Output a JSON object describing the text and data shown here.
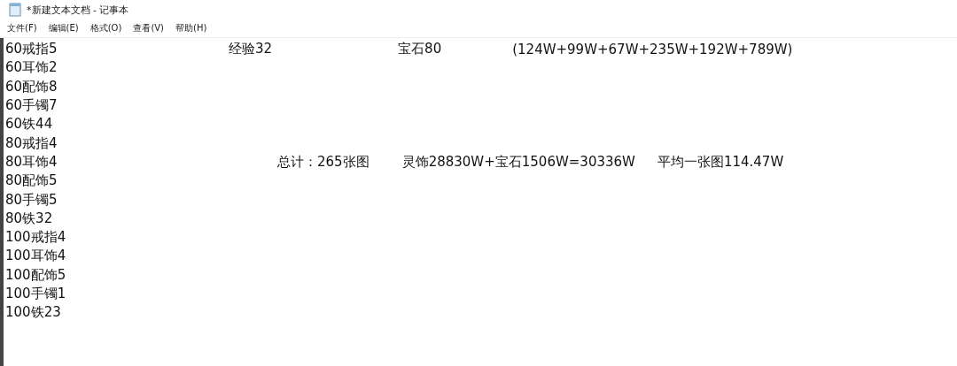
{
  "window": {
    "title": "*新建文本文档 - 记事本"
  },
  "menu": [
    "文件(F)",
    "编辑(E)",
    "格式(O)",
    "查看(V)",
    "帮助(H)"
  ],
  "lines": [
    {
      "text": "60戒指5",
      "notes": [
        "经验32",
        "宝石80",
        "(124W+99W+67W+235W+192W+789W)"
      ]
    },
    {
      "text": "60耳饰2"
    },
    {
      "text": "60配饰8"
    },
    {
      "text": "60手镯7"
    },
    {
      "text": "60铁44"
    },
    {
      "text": "80戒指4"
    },
    {
      "text": "80耳饰4",
      "notes": [
        "总计：265张图",
        "灵饰28830W+宝石1506W=30336W",
        "平均一张图114.47W"
      ]
    },
    {
      "text": "80配饰5"
    },
    {
      "text": "80手镯5"
    },
    {
      "text": "80铁32"
    },
    {
      "text": "100戒指4"
    },
    {
      "text": "100耳饰4"
    },
    {
      "text": "100配饰5"
    },
    {
      "text": "100手镯1"
    },
    {
      "text": "100铁23"
    }
  ]
}
